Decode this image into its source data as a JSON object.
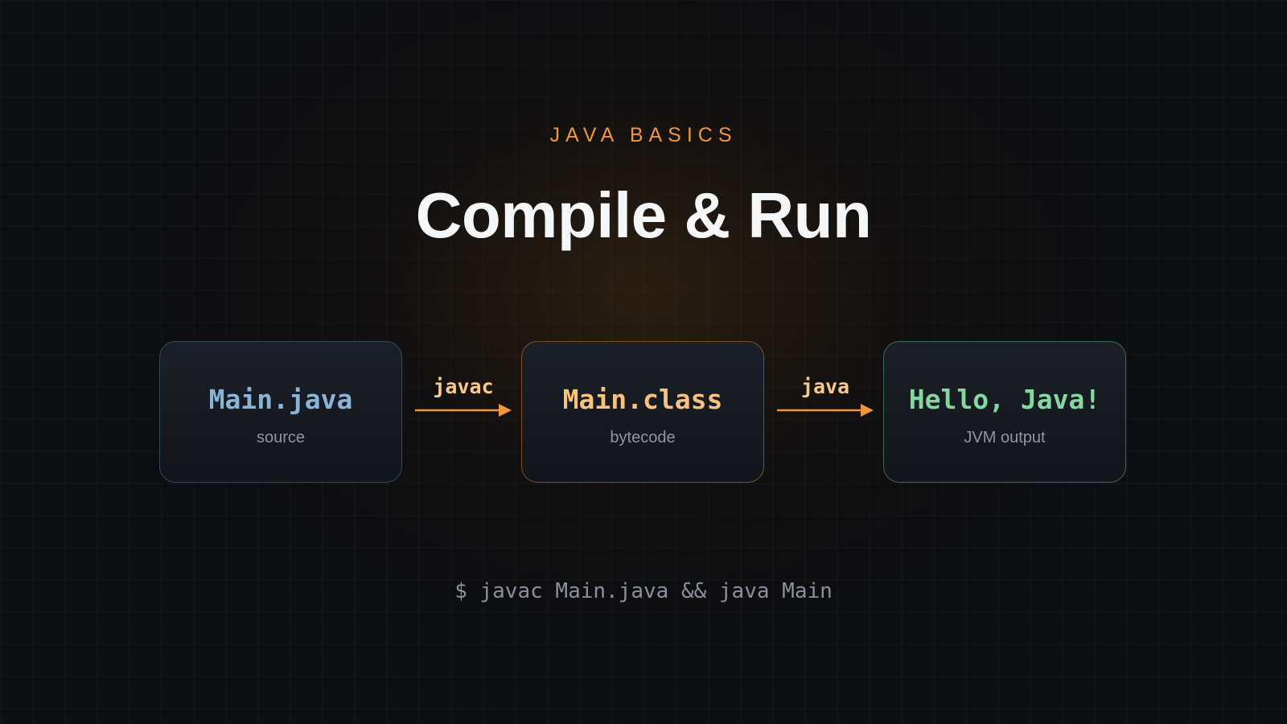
{
  "header": {
    "eyebrow": "JAVA BASICS",
    "title": "Compile & Run"
  },
  "pipeline": {
    "nodes": [
      {
        "name": "Main.java",
        "caption": "source",
        "color": "#8ab4d6",
        "border_color": "#34495c"
      },
      {
        "name": "Main.class",
        "caption": "bytecode",
        "color": "#f7c27d",
        "border_color": "#7d5223"
      },
      {
        "name": "Hello, Java!",
        "caption": "JVM output",
        "color": "#86d6a2",
        "border_color": "#3c6a53"
      }
    ],
    "edges": [
      {
        "label": "javac",
        "from": "Main.java",
        "to": "Main.class",
        "icon": "arrow-right-icon"
      },
      {
        "label": "java",
        "from": "Main.class",
        "to": "Hello, Java!",
        "icon": "arrow-right-icon"
      }
    ],
    "arrow_color": "#f0963a"
  },
  "footer": {
    "command": "$ javac Main.java && java Main"
  }
}
